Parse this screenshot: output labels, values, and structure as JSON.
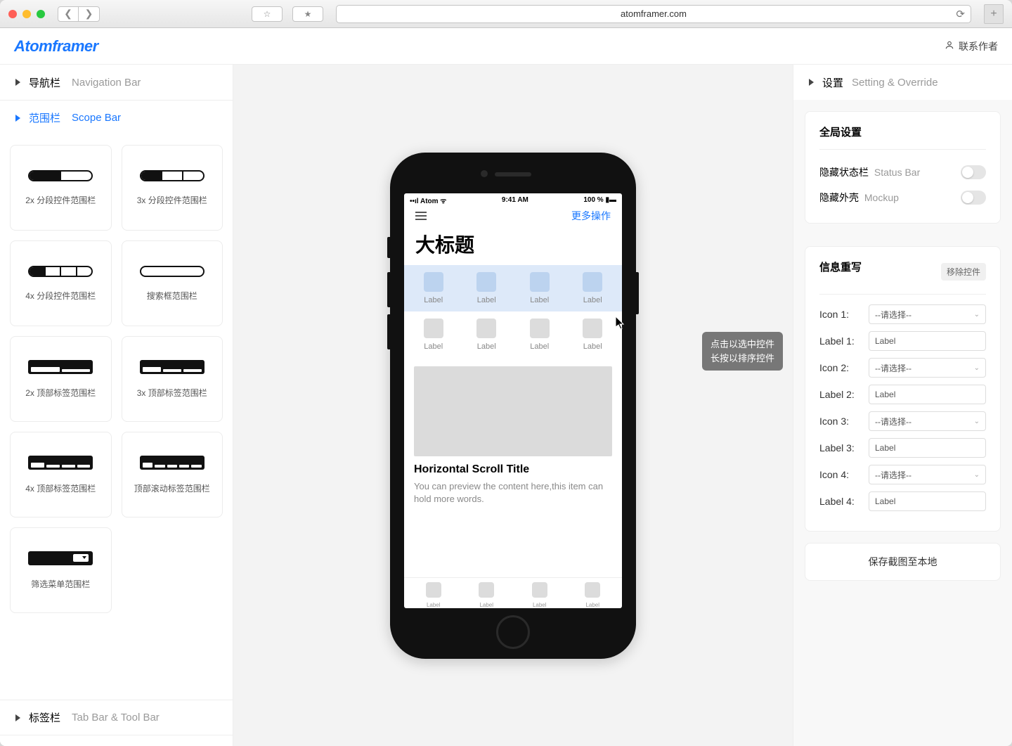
{
  "browser": {
    "url": "atomframer.com"
  },
  "app": {
    "logo": "Atomframer",
    "contact": "联系作者"
  },
  "left": {
    "sections": [
      {
        "cn": "导航栏",
        "en": "Navigation Bar",
        "active": false
      },
      {
        "cn": "范围栏",
        "en": "Scope Bar",
        "active": true
      },
      {
        "cn": "标签栏",
        "en": "Tab Bar & Tool Bar",
        "active": false
      }
    ],
    "cards": [
      "2x 分段控件范围栏",
      "3x 分段控件范围栏",
      "4x 分段控件范围栏",
      "搜索框范围栏",
      "2x 顶部标签范围栏",
      "3x 顶部标签范围栏",
      "4x 顶部标签范围栏",
      "顶部滚动标签范围栏",
      "筛选菜单范围栏"
    ]
  },
  "center": {
    "tooltip_l1": "点击以选中控件",
    "tooltip_l2": "长按以排序控件",
    "status": {
      "carrier": "Atom",
      "time": "9:41 AM",
      "battery": "100 %"
    },
    "nav_action": "更多操作",
    "big_title": "大标题",
    "label": "Label",
    "feed_title": "Horizontal Scroll Title",
    "feed_body": "You can preview the content here,this item can hold more words."
  },
  "right": {
    "header": {
      "cn": "设置",
      "en": "Setting & Override"
    },
    "global": {
      "title": "全局设置",
      "rows": [
        {
          "cn": "隐藏状态栏",
          "en": "Status Bar"
        },
        {
          "cn": "隐藏外壳",
          "en": "Mockup"
        }
      ]
    },
    "override": {
      "title": "信息重写",
      "remove": "移除控件",
      "select_placeholder": "--请选择--",
      "input_value": "Label",
      "fields": [
        {
          "label": "Icon 1:",
          "type": "select"
        },
        {
          "label": "Label 1:",
          "type": "input"
        },
        {
          "label": "Icon 2:",
          "type": "select"
        },
        {
          "label": "Label 2:",
          "type": "input"
        },
        {
          "label": "Icon 3:",
          "type": "select"
        },
        {
          "label": "Label 3:",
          "type": "input"
        },
        {
          "label": "Icon 4:",
          "type": "select"
        },
        {
          "label": "Label 4:",
          "type": "input"
        }
      ]
    },
    "save": "保存截图至本地"
  }
}
